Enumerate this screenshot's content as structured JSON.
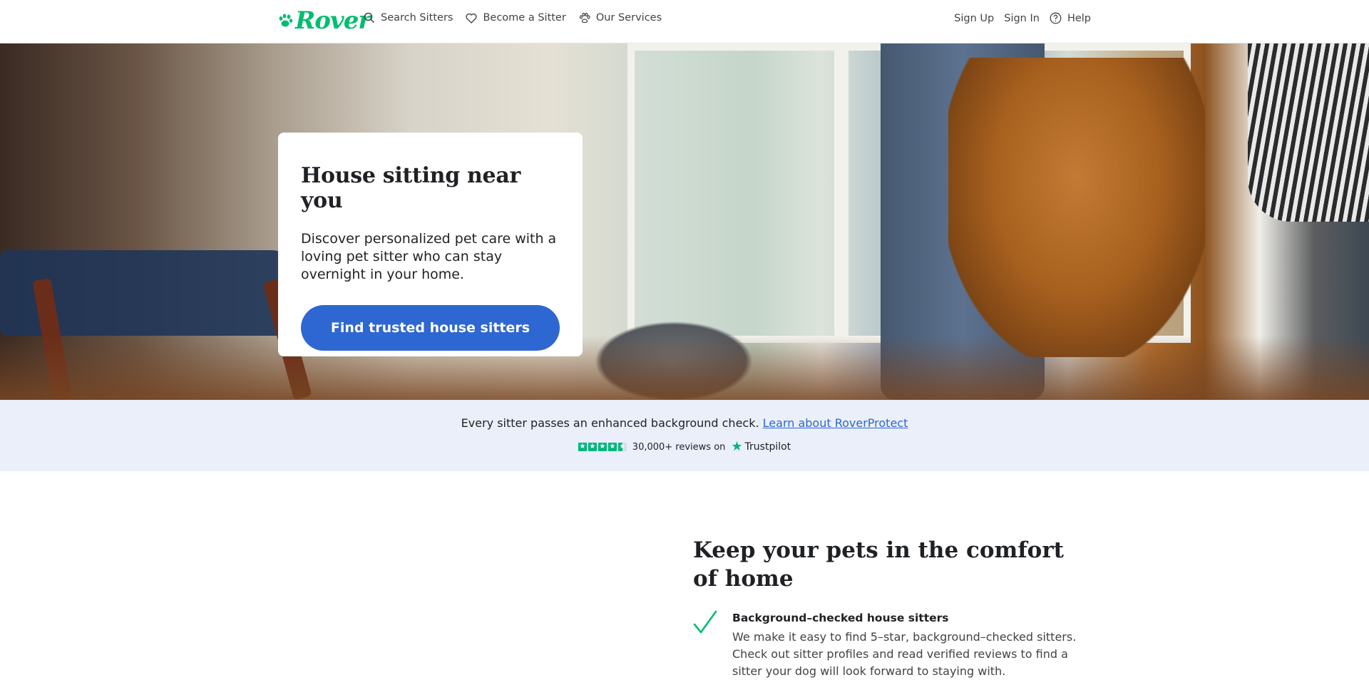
{
  "header": {
    "logo_text": "Rover",
    "nav": [
      {
        "label": "Search Sitters",
        "icon": "search-icon"
      },
      {
        "label": "Become a Sitter",
        "icon": "heart-icon"
      },
      {
        "label": "Our Services",
        "icon": "paw-icon"
      }
    ],
    "sign_up": "Sign Up",
    "sign_in": "Sign In",
    "help": "Help"
  },
  "hero": {
    "title": "House sitting near you",
    "description": "Discover personalized pet care with a loving pet sitter who can stay overnight in your home.",
    "cta": "Find trusted house sitters"
  },
  "trust": {
    "text": "Every sitter passes an enhanced background check.",
    "link": "Learn about RoverProtect",
    "reviews": "30,000+ reviews on",
    "brand": "Trustpilot"
  },
  "comfort": {
    "title": "Keep your pets in the comfort of home",
    "feature": {
      "title": "Background–checked house sitters",
      "description": "We make it easy to find 5–star, background–checked sitters. Check out sitter profiles and read verified reviews to find a sitter your dog will look forward to staying with."
    }
  },
  "colors": {
    "brand_green": "#00bd70",
    "primary_blue": "#2e67d1",
    "banner_bg": "#eaeff9",
    "trustpilot_green": "#00b67a"
  }
}
